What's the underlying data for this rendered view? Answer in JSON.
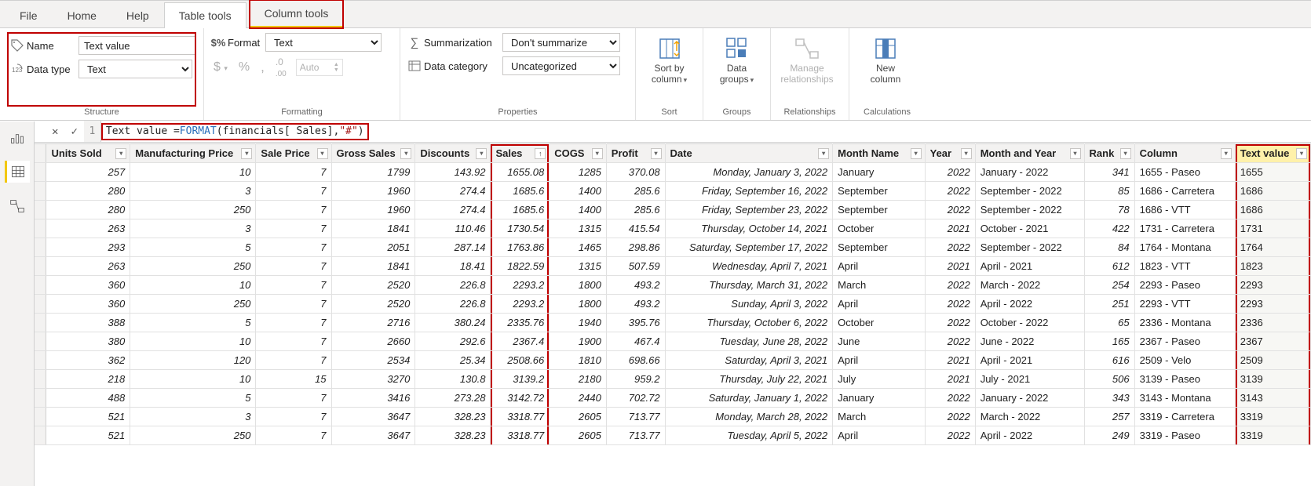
{
  "ribbonTabs": {
    "file": "File",
    "home": "Home",
    "help": "Help",
    "tableTools": "Table tools",
    "columnTools": "Column tools"
  },
  "structure": {
    "nameLabel": "Name",
    "nameValue": "Text value",
    "dataTypeLabel": "Data type",
    "dataTypeValue": "Text",
    "groupLabel": "Structure"
  },
  "formatting": {
    "formatLabel": "Format",
    "formatValue": "Text",
    "autoLabel": "Auto",
    "groupLabel": "Formatting"
  },
  "properties": {
    "summarizationLabel": "Summarization",
    "summarizationValue": "Don't summarize",
    "dataCategoryLabel": "Data category",
    "dataCategoryValue": "Uncategorized",
    "groupLabel": "Properties"
  },
  "sort": {
    "btn1a": "Sort by",
    "btn1b": "column",
    "groupLabel": "Sort"
  },
  "groups": {
    "btn1a": "Data",
    "btn1b": "groups",
    "groupLabel": "Groups"
  },
  "relationships": {
    "btn1a": "Manage",
    "btn1b": "relationships",
    "groupLabel": "Relationships"
  },
  "calculations": {
    "btn1a": "New",
    "btn1b": "column",
    "groupLabel": "Calculations"
  },
  "formula": {
    "lineNo": "1",
    "lhs": "Text value = ",
    "fn": "FORMAT",
    "open": "(",
    "arg1": "financials[ Sales]",
    "sep": ", ",
    "arg2": "\"#\"",
    "close": ")"
  },
  "columns": [
    "Units Sold",
    "Manufacturing Price",
    "Sale Price",
    "Gross Sales",
    "Discounts",
    "Sales",
    "COGS",
    "Profit",
    "Date",
    "Month Name",
    "Year",
    "Month and Year",
    "Rank",
    "Column",
    "Text value"
  ],
  "rows": [
    {
      "units": "257",
      "mfg": "10",
      "sale": "7",
      "gross": "1799",
      "disc": "143.92",
      "sales": "1655.08",
      "cogs": "1285",
      "profit": "370.08",
      "date": "Monday, January 3, 2022",
      "month": "January",
      "year": "2022",
      "monthYear": "January - 2022",
      "rank": "341",
      "col": "1655 - Paseo",
      "tv": "1655"
    },
    {
      "units": "280",
      "mfg": "3",
      "sale": "7",
      "gross": "1960",
      "disc": "274.4",
      "sales": "1685.6",
      "cogs": "1400",
      "profit": "285.6",
      "date": "Friday, September 16, 2022",
      "month": "September",
      "year": "2022",
      "monthYear": "September - 2022",
      "rank": "85",
      "col": "1686 - Carretera",
      "tv": "1686"
    },
    {
      "units": "280",
      "mfg": "250",
      "sale": "7",
      "gross": "1960",
      "disc": "274.4",
      "sales": "1685.6",
      "cogs": "1400",
      "profit": "285.6",
      "date": "Friday, September 23, 2022",
      "month": "September",
      "year": "2022",
      "monthYear": "September - 2022",
      "rank": "78",
      "col": "1686 - VTT",
      "tv": "1686"
    },
    {
      "units": "263",
      "mfg": "3",
      "sale": "7",
      "gross": "1841",
      "disc": "110.46",
      "sales": "1730.54",
      "cogs": "1315",
      "profit": "415.54",
      "date": "Thursday, October 14, 2021",
      "month": "October",
      "year": "2021",
      "monthYear": "October - 2021",
      "rank": "422",
      "col": "1731 - Carretera",
      "tv": "1731"
    },
    {
      "units": "293",
      "mfg": "5",
      "sale": "7",
      "gross": "2051",
      "disc": "287.14",
      "sales": "1763.86",
      "cogs": "1465",
      "profit": "298.86",
      "date": "Saturday, September 17, 2022",
      "month": "September",
      "year": "2022",
      "monthYear": "September - 2022",
      "rank": "84",
      "col": "1764 - Montana",
      "tv": "1764"
    },
    {
      "units": "263",
      "mfg": "250",
      "sale": "7",
      "gross": "1841",
      "disc": "18.41",
      "sales": "1822.59",
      "cogs": "1315",
      "profit": "507.59",
      "date": "Wednesday, April 7, 2021",
      "month": "April",
      "year": "2021",
      "monthYear": "April - 2021",
      "rank": "612",
      "col": "1823 - VTT",
      "tv": "1823"
    },
    {
      "units": "360",
      "mfg": "10",
      "sale": "7",
      "gross": "2520",
      "disc": "226.8",
      "sales": "2293.2",
      "cogs": "1800",
      "profit": "493.2",
      "date": "Thursday, March 31, 2022",
      "month": "March",
      "year": "2022",
      "monthYear": "March - 2022",
      "rank": "254",
      "col": "2293 - Paseo",
      "tv": "2293"
    },
    {
      "units": "360",
      "mfg": "250",
      "sale": "7",
      "gross": "2520",
      "disc": "226.8",
      "sales": "2293.2",
      "cogs": "1800",
      "profit": "493.2",
      "date": "Sunday, April 3, 2022",
      "month": "April",
      "year": "2022",
      "monthYear": "April - 2022",
      "rank": "251",
      "col": "2293 - VTT",
      "tv": "2293"
    },
    {
      "units": "388",
      "mfg": "5",
      "sale": "7",
      "gross": "2716",
      "disc": "380.24",
      "sales": "2335.76",
      "cogs": "1940",
      "profit": "395.76",
      "date": "Thursday, October 6, 2022",
      "month": "October",
      "year": "2022",
      "monthYear": "October - 2022",
      "rank": "65",
      "col": "2336 - Montana",
      "tv": "2336"
    },
    {
      "units": "380",
      "mfg": "10",
      "sale": "7",
      "gross": "2660",
      "disc": "292.6",
      "sales": "2367.4",
      "cogs": "1900",
      "profit": "467.4",
      "date": "Tuesday, June 28, 2022",
      "month": "June",
      "year": "2022",
      "monthYear": "June - 2022",
      "rank": "165",
      "col": "2367 - Paseo",
      "tv": "2367"
    },
    {
      "units": "362",
      "mfg": "120",
      "sale": "7",
      "gross": "2534",
      "disc": "25.34",
      "sales": "2508.66",
      "cogs": "1810",
      "profit": "698.66",
      "date": "Saturday, April 3, 2021",
      "month": "April",
      "year": "2021",
      "monthYear": "April - 2021",
      "rank": "616",
      "col": "2509 - Velo",
      "tv": "2509"
    },
    {
      "units": "218",
      "mfg": "10",
      "sale": "15",
      "gross": "3270",
      "disc": "130.8",
      "sales": "3139.2",
      "cogs": "2180",
      "profit": "959.2",
      "date": "Thursday, July 22, 2021",
      "month": "July",
      "year": "2021",
      "monthYear": "July - 2021",
      "rank": "506",
      "col": "3139 - Paseo",
      "tv": "3139"
    },
    {
      "units": "488",
      "mfg": "5",
      "sale": "7",
      "gross": "3416",
      "disc": "273.28",
      "sales": "3142.72",
      "cogs": "2440",
      "profit": "702.72",
      "date": "Saturday, January 1, 2022",
      "month": "January",
      "year": "2022",
      "monthYear": "January - 2022",
      "rank": "343",
      "col": "3143 - Montana",
      "tv": "3143"
    },
    {
      "units": "521",
      "mfg": "3",
      "sale": "7",
      "gross": "3647",
      "disc": "328.23",
      "sales": "3318.77",
      "cogs": "2605",
      "profit": "713.77",
      "date": "Monday, March 28, 2022",
      "month": "March",
      "year": "2022",
      "monthYear": "March - 2022",
      "rank": "257",
      "col": "3319 - Carretera",
      "tv": "3319"
    },
    {
      "units": "521",
      "mfg": "250",
      "sale": "7",
      "gross": "3647",
      "disc": "328.23",
      "sales": "3318.77",
      "cogs": "2605",
      "profit": "713.77",
      "date": "Tuesday, April 5, 2022",
      "month": "April",
      "year": "2022",
      "monthYear": "April - 2022",
      "rank": "249",
      "col": "3319 - Paseo",
      "tv": "3319"
    }
  ]
}
